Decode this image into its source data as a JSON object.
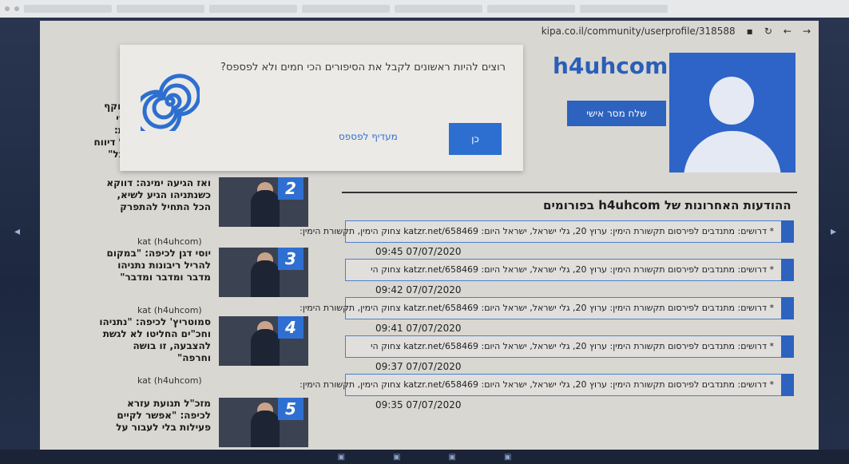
{
  "browser": {
    "url": "kipa.co.il/community/userprofile/318588"
  },
  "articles": [
    {
      "number": "2",
      "title": "ואז הגיעה ימינה: דווקא כשנתניהו הגיע לשיא, הכל התחיל להתפרק"
    },
    {
      "number": "3",
      "title": "יוסי דגן לכיפה: \"במקום להריל ריבונות נתניהו מדבר ומדבר ומדבר\"",
      "author": "kat (h4uhcom)"
    },
    {
      "number": "4",
      "title": "סמוטריץ' לכיפה: \"נתניהו וחכ\"ים החליטו לא לגשת להצבעה, זו בושה וחרפה\"",
      "author": "kat (h4uhcom)"
    },
    {
      "number": "5",
      "title": "מזכ\"ל תנועת עזרא לכיפה: \"אפשר לקיים פעילות בלי לעבור על",
      "author": "kat (h4uhcom)"
    }
  ],
  "left_partial": {
    "lines": [
      "זוקף",
      "רי",
      "ת:",
      "ל דיווח",
      "בל\""
    ]
  },
  "popup": {
    "message": "רוצים להיות ראשונים לקבל את הסיפורים הכי חמים ולא לפספס?",
    "confirm_label": "כן",
    "decline_label": "מעדיף לפספס"
  },
  "profile": {
    "username": "h4uhcom",
    "message_button": "שלח מסר אישי",
    "section_title": "ההודעות האחרונות של h4uhcom בפורומים"
  },
  "posts": [
    {
      "text": "* דרושים: מתנדבים לפירסום תקשורת הימין: ערוץ 20, גלי ישראל, ישראל היום: katzr.net/658469 צחוק הימין, תקשורת הימין:",
      "date": "09:45 07/07/2020"
    },
    {
      "text": "* דרושים: מתנדבים לפירסום תקשורת הימין: ערוץ 20, גלי ישראל, ישראל היום: katzr.net/658469 צחוק הי",
      "date": "09:42 07/07/2020"
    },
    {
      "text": "* דרושים: מתנדבים לפירסום תקשורת הימין: ערוץ 20, גלי ישראל, ישראל היום: katzr.net/658469 צחוק הימין, תקשורת הימין:",
      "date": "09:41 07/07/2020"
    },
    {
      "text": "* דרושים: מתנדבים לפירסום תקשורת הימין: ערוץ 20, גלי ישראל, ישראל היום: katzr.net/658469 צחוק הי",
      "date": "09:37 07/07/2020"
    },
    {
      "text": "* דרושים: מתנדבים לפירסום תקשורת הימין: ערוץ 20, גלי ישראל, ישראל היום: katzr.net/658469 צחוק הימין, תקשורת הימין:",
      "date": "09:35 07/07/2020"
    }
  ]
}
